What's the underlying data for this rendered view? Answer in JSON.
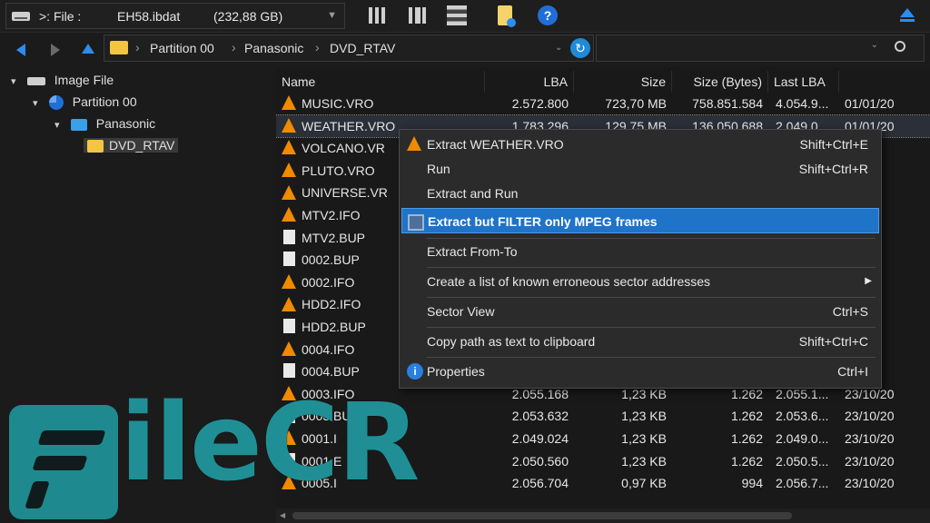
{
  "toolbar": {
    "drive_label": ">: File :",
    "drive_name": "EH58.ibdat",
    "drive_size": "(232,88 GB)"
  },
  "address": {
    "crumbs": [
      "Partition 00",
      "Panasonic",
      "DVD_RTAV"
    ]
  },
  "tree": {
    "items": [
      {
        "label": "Image File"
      },
      {
        "label": "Partition 00"
      },
      {
        "label": "Panasonic"
      },
      {
        "label": "DVD_RTAV"
      }
    ]
  },
  "list": {
    "columns": [
      "Name",
      "LBA",
      "Size",
      "Size (Bytes)",
      "Last LBA",
      ""
    ],
    "rows": [
      {
        "name": "MUSIC.VRO",
        "icon": "vlc-cone-icon",
        "lba": "2.572.800",
        "size": "723,70 MB",
        "bytes": "758.851.584",
        "last": "4.054.9...",
        "date": "01/01/20"
      },
      {
        "name": "WEATHER.VRO",
        "icon": "vlc-cone-icon",
        "lba": "1.783.296",
        "size": "129,75 MB",
        "bytes": "136.050.688",
        "last": "2.049.0...",
        "date": "01/01/20"
      },
      {
        "name": "VOLCANO.VR",
        "icon": "vlc-cone-icon",
        "lba": "",
        "size": "",
        "bytes": "",
        "last": "",
        "date": "/20"
      },
      {
        "name": "PLUTO.VRO",
        "icon": "vlc-cone-icon",
        "lba": "",
        "size": "",
        "bytes": "",
        "last": "",
        "date": "/20"
      },
      {
        "name": "UNIVERSE.VR",
        "icon": "vlc-cone-icon",
        "lba": "",
        "size": "",
        "bytes": "",
        "last": "",
        "date": "/20"
      },
      {
        "name": "MTV2.IFO",
        "icon": "vlc-cone-icon",
        "lba": "",
        "size": "",
        "bytes": "",
        "last": "",
        "date": "/20"
      },
      {
        "name": "MTV2.BUP",
        "icon": "file-icon",
        "lba": "",
        "size": "",
        "bytes": "",
        "last": "",
        "date": "/20"
      },
      {
        "name": "0002.BUP",
        "icon": "file-icon",
        "lba": "",
        "size": "",
        "bytes": "",
        "last": "",
        "date": "/20"
      },
      {
        "name": "0002.IFO",
        "icon": "vlc-cone-icon",
        "lba": "",
        "size": "",
        "bytes": "",
        "last": "",
        "date": "/20"
      },
      {
        "name": "HDD2.IFO",
        "icon": "vlc-cone-icon",
        "lba": "",
        "size": "",
        "bytes": "",
        "last": "",
        "date": "/20"
      },
      {
        "name": "HDD2.BUP",
        "icon": "file-icon",
        "lba": "",
        "size": "",
        "bytes": "",
        "last": "",
        "date": "/20"
      },
      {
        "name": "0004.IFO",
        "icon": "vlc-cone-icon",
        "lba": "",
        "size": "",
        "bytes": "",
        "last": "",
        "date": "/20"
      },
      {
        "name": "0004.BUP",
        "icon": "file-icon",
        "lba": "",
        "size": "",
        "bytes": "",
        "last": "",
        "date": "/20"
      },
      {
        "name": "0003.IFO",
        "icon": "vlc-cone-icon",
        "lba": "2.055.168",
        "size": "1,23 KB",
        "bytes": "1.262",
        "last": "2.055.1...",
        "date": "23/10/20"
      },
      {
        "name": "0003.BUP",
        "icon": "file-icon",
        "lba": "2.053.632",
        "size": "1,23 KB",
        "bytes": "1.262",
        "last": "2.053.6...",
        "date": "23/10/20"
      },
      {
        "name": "0001.I",
        "icon": "vlc-cone-icon",
        "lba": "2.049.024",
        "size": "1,23 KB",
        "bytes": "1.262",
        "last": "2.049.0...",
        "date": "23/10/20"
      },
      {
        "name": "0001.E",
        "icon": "file-icon",
        "lba": "2.050.560",
        "size": "1,23 KB",
        "bytes": "1.262",
        "last": "2.050.5...",
        "date": "23/10/20"
      },
      {
        "name": "0005.I",
        "icon": "vlc-cone-icon",
        "lba": "2.056.704",
        "size": "0,97 KB",
        "bytes": "994",
        "last": "2.056.7...",
        "date": "23/10/20"
      }
    ]
  },
  "context_menu": {
    "items": [
      {
        "label": "Extract WEATHER.VRO",
        "shortcut": "Shift+Ctrl+E",
        "icon": "vlc-cone-icon"
      },
      {
        "label": "Run",
        "shortcut": "Shift+Ctrl+R"
      },
      {
        "label": "Extract and Run",
        "shortcut": ""
      },
      {
        "label": "Extract but FILTER only MPEG frames",
        "shortcut": "",
        "icon": "film-icon",
        "highlighted": true
      },
      {
        "label": "Extract From-To",
        "shortcut": ""
      },
      {
        "label": "Create a list of known erroneous sector addresses",
        "shortcut": "",
        "submenu": true
      },
      {
        "label": "Sector View",
        "shortcut": "Ctrl+S"
      },
      {
        "label": "Copy path as text to clipboard",
        "shortcut": "Shift+Ctrl+C"
      },
      {
        "label": "Properties",
        "shortcut": "Ctrl+I",
        "icon": "info-icon"
      }
    ]
  },
  "watermark": {
    "text": "ileCR"
  },
  "colors": {
    "accent": "#1f73c8",
    "vlc_orange": "#f08a00",
    "folder": "#f4c542",
    "watermark": "#1f8f95"
  }
}
